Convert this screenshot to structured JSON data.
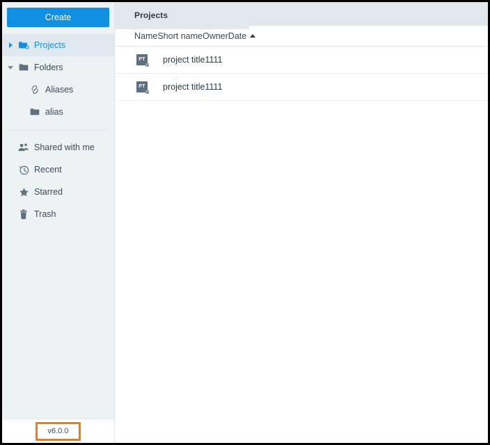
{
  "sidebar": {
    "create_label": "Create",
    "items": [
      {
        "label": "Projects",
        "icon": "folders-icon",
        "twisty": "collapsed",
        "selected": true,
        "indent": false
      },
      {
        "label": "Folders",
        "icon": "folder-icon",
        "twisty": "expanded",
        "selected": false,
        "indent": false
      },
      {
        "label": "Aliases",
        "icon": "link-icon",
        "twisty": "none",
        "selected": false,
        "indent": true
      },
      {
        "label": "alias",
        "icon": "folder-icon",
        "twisty": "none",
        "selected": false,
        "indent": true
      }
    ],
    "secondary_items": [
      {
        "label": "Shared with me",
        "icon": "people-icon"
      },
      {
        "label": "Recent",
        "icon": "clock-icon"
      },
      {
        "label": "Starred",
        "icon": "star-icon"
      },
      {
        "label": "Trash",
        "icon": "trash-icon"
      }
    ],
    "version": "v6.0.0"
  },
  "main": {
    "breadcrumb": "Projects",
    "columns": [
      "Name",
      "Short name",
      "Owner",
      "Date"
    ],
    "column_header_text": "NameShort nameOwnerDate",
    "sort_column": "Date",
    "sort_direction": "ascending",
    "rows": [
      {
        "name": "project title1111",
        "icon": "project-icon",
        "icon_text": "PT"
      },
      {
        "name": "project title1111",
        "icon": "project-icon",
        "icon_text": "PT"
      }
    ]
  },
  "colors": {
    "accent_blue": "#1190e3",
    "sidebar_bg": "#edf2f5",
    "selected_bg": "#dfe8ee",
    "breadcrumb_bg": "#e0e8ee",
    "highlight_orange": "#ef7b12",
    "project_icon": "#5c7080"
  }
}
